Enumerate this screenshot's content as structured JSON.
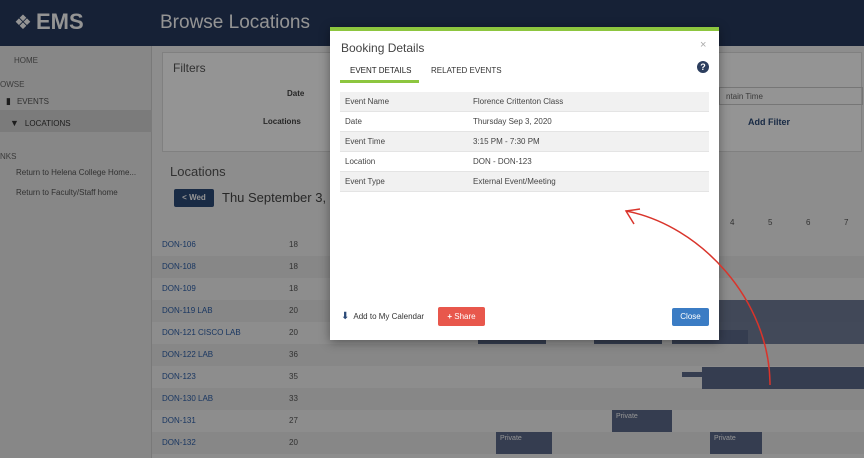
{
  "app": {
    "logo_text": "EMS",
    "page_title": "Browse Locations"
  },
  "sidebar": {
    "home": "HOME",
    "browse_section": "OWSE",
    "events": "EVENTS",
    "locations": "LOCATIONS",
    "links_section": "NKS",
    "link_1": "Return to Helena College Home...",
    "link_2": "Return to Faculty/Staff home"
  },
  "filters": {
    "title": "Filters",
    "date_label": "Date",
    "locations_label": "Locations",
    "maintain_time": "ntain Time",
    "add_filter": "Add Filter"
  },
  "locations": {
    "title": "Locations",
    "prev_button": "< Wed",
    "date_text": "Thu September 3,",
    "hours": [
      "4",
      "5",
      "6",
      "7"
    ],
    "rows": [
      {
        "room": "DON-106",
        "cap": "18"
      },
      {
        "room": "DON-108",
        "cap": "18"
      },
      {
        "room": "DON-109",
        "cap": "18"
      },
      {
        "room": "DON-119 LAB",
        "cap": "20"
      },
      {
        "room": "DON-121 CISCO LAB",
        "cap": "20"
      },
      {
        "room": "DON-122 LAB",
        "cap": "36"
      },
      {
        "room": "DON-123",
        "cap": "35"
      },
      {
        "room": "DON-130 LAB",
        "cap": "33"
      },
      {
        "room": "DON-131",
        "cap": "27"
      },
      {
        "room": "DON-132",
        "cap": "20"
      }
    ],
    "private_label": "Private"
  },
  "modal": {
    "title": "Booking Details",
    "close_glyph": "×",
    "tabs": [
      "EVENT DETAILS",
      "RELATED EVENTS"
    ],
    "help_glyph": "?",
    "details": [
      {
        "key": "Event Name",
        "value": "Florence Crittenton Class"
      },
      {
        "key": "Date",
        "value": "Thursday Sep 3, 2020"
      },
      {
        "key": "Event Time",
        "value": "3:15 PM - 7:30 PM"
      },
      {
        "key": "Location",
        "value": "DON - DON-123"
      },
      {
        "key": "Event Type",
        "value": "External Event/Meeting"
      }
    ],
    "add_calendar": "Add to My Calendar",
    "share": "Share",
    "share_glyph": "+",
    "close_button": "Close"
  },
  "icons": {
    "logo": "ems-logo-icon",
    "events": "bookmark-icon",
    "locations": "map-pin-icon",
    "download": "download-icon",
    "help": "help-icon"
  },
  "colors": {
    "header": "#263a5e",
    "accent_green": "#8dc63f",
    "share_red": "#e8574c",
    "close_blue": "#3b7cc4",
    "annotation_red": "#d9342b"
  }
}
